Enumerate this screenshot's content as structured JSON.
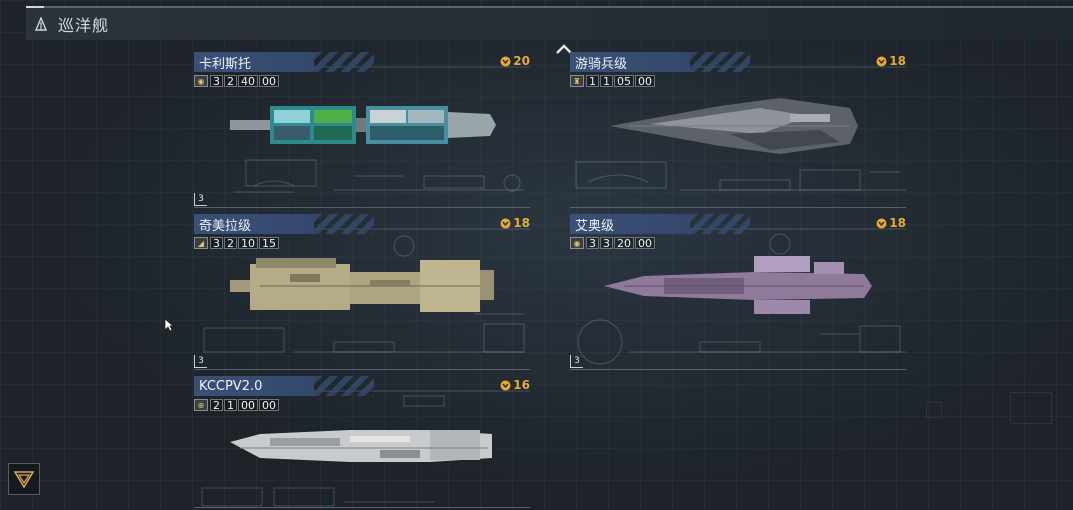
{
  "header": {
    "title": "巡洋舰",
    "icon": "fleet-class-icon"
  },
  "scroll_up_icon": "chevron-up-icon",
  "colors": {
    "accent_gold": "#e8a93a",
    "name_tag_blue": "#3a5077",
    "background": "#1d2329"
  },
  "ships": [
    {
      "name": "卡利斯托",
      "tier": "20",
      "version": [
        "3",
        "2",
        "40",
        "00"
      ],
      "faction_icon": "faction-icon",
      "level": "3",
      "hull_color": "#9aa6ad"
    },
    {
      "name": "游骑兵级",
      "tier": "18",
      "version": [
        "1",
        "1",
        "05",
        "00"
      ],
      "faction_icon": "faction-icon",
      "level": "",
      "hull_color": "#8a8f95"
    },
    {
      "name": "奇美拉级",
      "tier": "18",
      "version": [
        "3",
        "2",
        "10",
        "15"
      ],
      "faction_icon": "faction-icon",
      "level": "3",
      "hull_color": "#b7ac8a"
    },
    {
      "name": "艾奥级",
      "tier": "18",
      "version": [
        "3",
        "3",
        "20",
        "00"
      ],
      "faction_icon": "faction-icon",
      "level": "3",
      "hull_color": "#9c86a8"
    },
    {
      "name": "KCCPV2.0",
      "tier": "16",
      "version": [
        "2",
        "1",
        "00",
        "00"
      ],
      "faction_icon": "faction-icon",
      "level": "",
      "hull_color": "#c4c6c8"
    }
  ],
  "corner_menu_icon": "triangle-menu-icon"
}
